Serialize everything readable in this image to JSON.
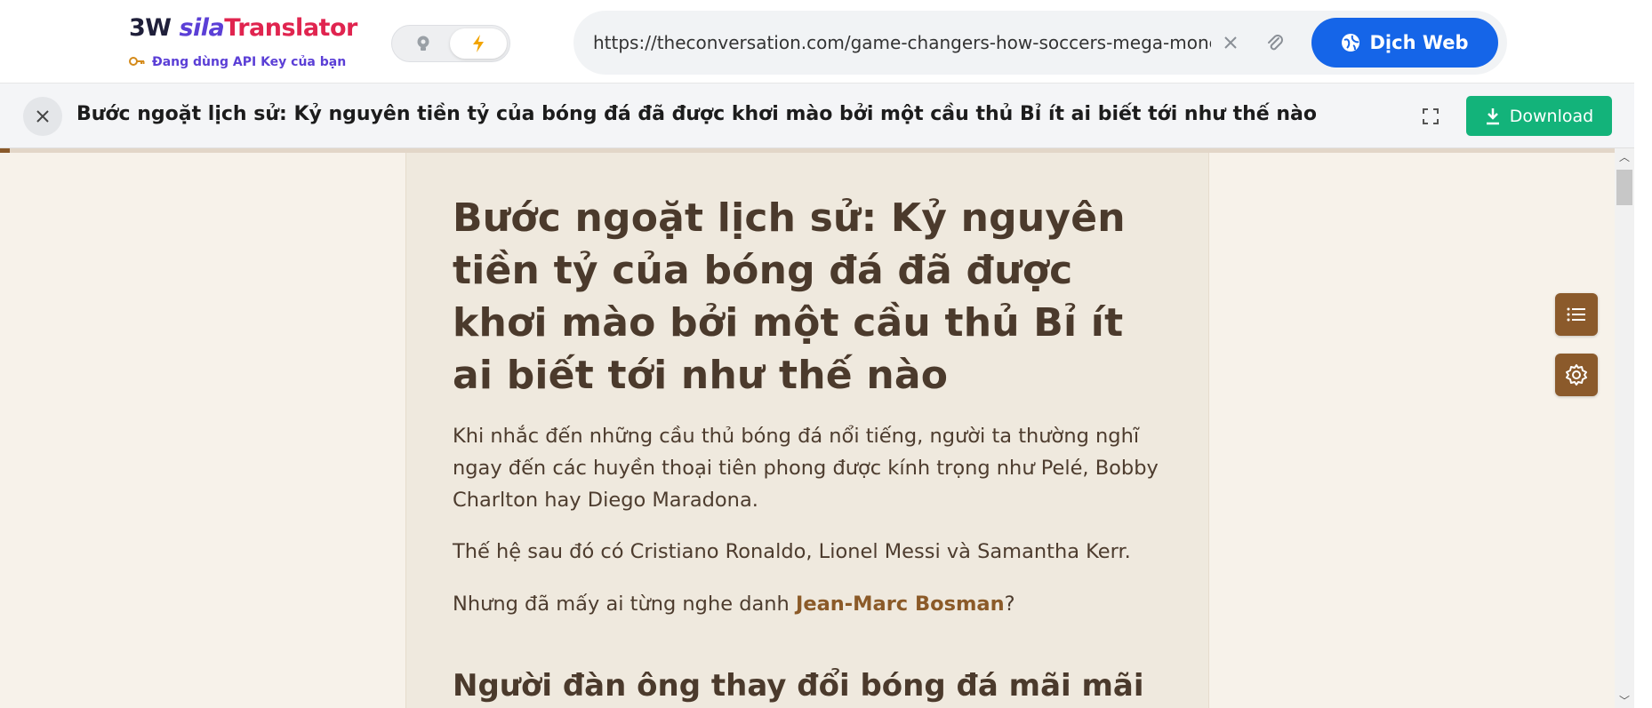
{
  "app": {
    "logo_part1": "3W ",
    "logo_part2": "sila",
    "logo_part3": "Translator",
    "api_note": "Đang dùng API Key của bạn"
  },
  "toggle": {
    "left_icon": "bulb-icon",
    "right_icon": "lightning-icon",
    "active": "right"
  },
  "urlbar": {
    "url": "https://theconversation.com/game-changers-how-soccers-mega-money-era-was-sparked-by-a-little-known-belgian-player",
    "translate_label": "Dịch Web"
  },
  "docbar": {
    "title": "Bước ngoặt lịch sử: Kỷ nguyên tiền tỷ của bóng đá đã được khơi mào bởi một cầu thủ Bỉ ít ai biết tới như thế nào",
    "download_label": "Download"
  },
  "progress": {
    "fraction": 0.006
  },
  "article": {
    "heading": "Bước ngoặt lịch sử: Kỷ nguyên tiền tỷ của bóng đá đã được khơi mào bởi một cầu thủ Bỉ ít ai biết tới như thế nào",
    "p1": "Khi nhắc đến những cầu thủ bóng đá nổi tiếng, người ta thường nghĩ ngay đến các huyền thoại tiên phong được kính trọng như Pelé, Bobby Charlton hay Diego Maradona.",
    "p2": "Thế hệ sau đó có Cristiano Ronaldo, Lionel Messi và Samantha Kerr.",
    "p3_before": "Nhưng đã mấy ai từng nghe danh ",
    "p3_link": "Jean-Marc Bosman",
    "p3_after": "?",
    "subheading": "Người đàn ông thay đổi bóng đá mãi mãi"
  },
  "colors": {
    "accent_blue": "#1565e8",
    "download_green": "#13b37a",
    "brown": "#8b5a2b"
  }
}
